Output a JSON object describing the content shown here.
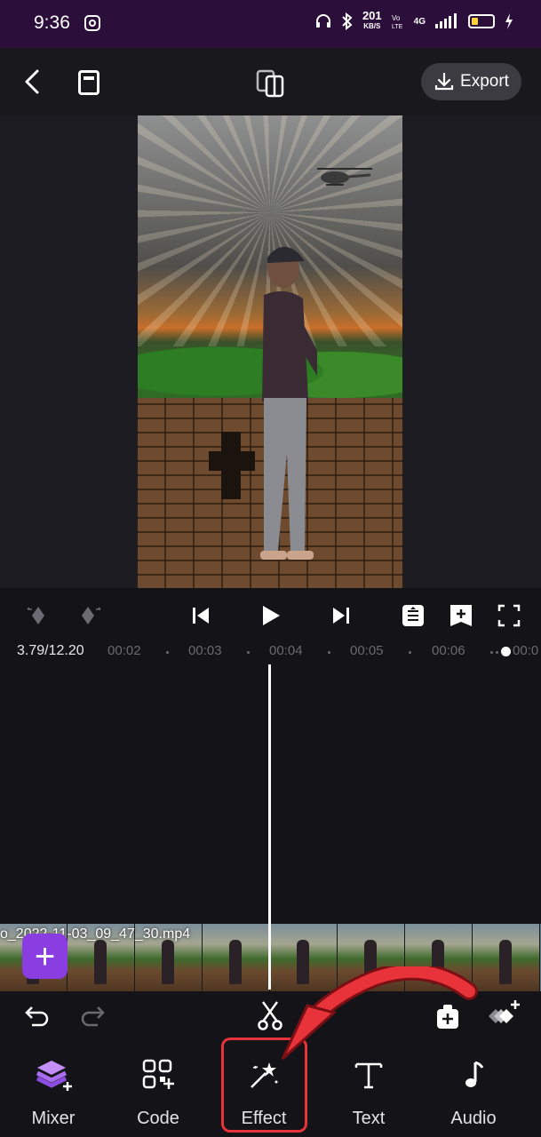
{
  "status_bar": {
    "time": "9:36",
    "speed_value": "201",
    "speed_unit": "KB/S",
    "network": "4G"
  },
  "topbar": {
    "export_label": "Export"
  },
  "playback": {
    "current_time": "3.79/12.20",
    "ticks": [
      "00:02",
      "00:03",
      "00:04",
      "00:05",
      "00:06",
      "00:0"
    ]
  },
  "timeline": {
    "clip_name": "o_2022-11-03_09_47_30.mp4",
    "add_label": "+"
  },
  "tabs": [
    {
      "label": "Mixer"
    },
    {
      "label": "Code"
    },
    {
      "label": "Effect"
    },
    {
      "label": "Text"
    },
    {
      "label": "Audio"
    }
  ],
  "colors": {
    "accent_purple": "#8a3de0",
    "highlight_red": "#e8333a",
    "status_bar_bg": "#2b0f3a"
  }
}
